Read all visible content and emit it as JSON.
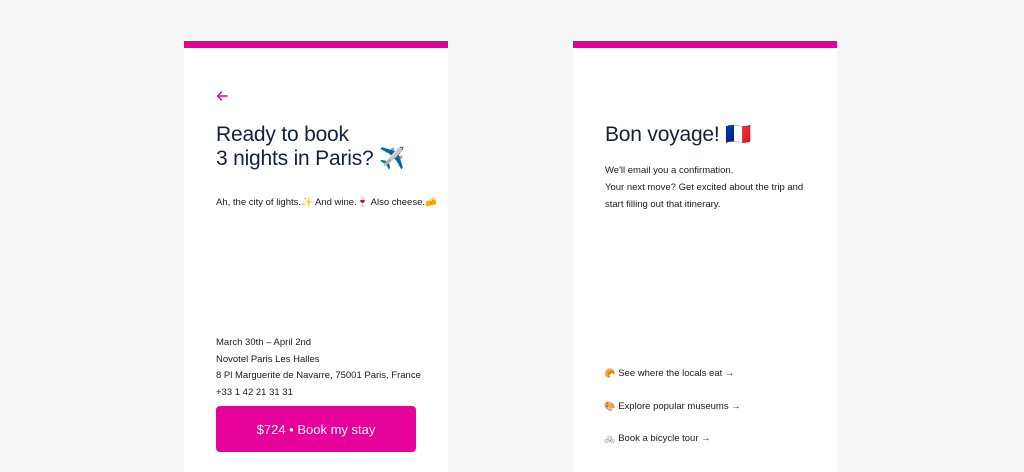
{
  "left_card": {
    "title_line1": "Ready to book",
    "title_line2": "3 nights in Paris? ✈️",
    "subtitle": "Ah, the city of lights.✨ And wine.🍷 Also cheese.🧀",
    "details": {
      "dates": "March 30th – April 2nd",
      "hotel": "Novotel Paris Les Halles",
      "address": "8 Pl Marguerite de Navarre, 75001 Paris, France",
      "phone": "+33 1 42 21 31 31"
    },
    "book_button_label": "$724 • Book my stay"
  },
  "right_card": {
    "title": "Bon voyage! 🇫🇷",
    "lines": [
      "We'll email you a confirmation.",
      "Your next move? Get excited about the trip and",
      "start filling out that itinerary."
    ],
    "links": [
      {
        "emoji": "🥐",
        "label": "See where the locals eat →"
      },
      {
        "emoji": "🎨",
        "label": "Explore popular museums →"
      },
      {
        "emoji": "🚲",
        "label": "Book a bicycle tour →"
      }
    ]
  },
  "colors": {
    "accent": "#e6009a",
    "text": "#14213d",
    "background": "#f7f7f7"
  },
  "icons": {
    "back": "arrow-left-icon"
  }
}
